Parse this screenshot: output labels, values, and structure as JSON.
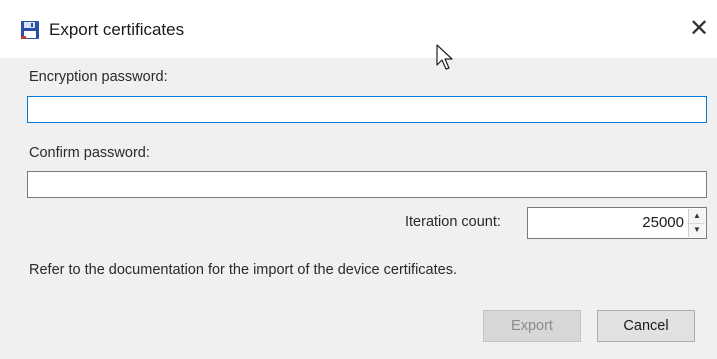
{
  "dialog": {
    "title": "Export certificates",
    "close_label": "✕"
  },
  "form": {
    "encryption_password": {
      "label": "Encryption password:",
      "value": ""
    },
    "confirm_password": {
      "label": "Confirm password:",
      "value": ""
    },
    "iteration_count": {
      "label": "Iteration count:",
      "value": "25000"
    },
    "info_text": "Refer to the documentation for the import of the device certificates."
  },
  "buttons": {
    "export_label": "Export",
    "cancel_label": "Cancel"
  },
  "colors": {
    "focus_border": "#0078d7",
    "disabled_text": "#8c8c8c"
  }
}
